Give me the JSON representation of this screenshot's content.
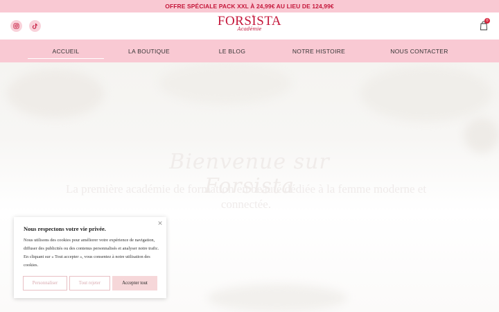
{
  "promo": {
    "text": "OFFRE SPÉCIALE PACK XXL À 24,99€ AU LIEU DE 124,99€"
  },
  "header": {
    "social": [
      {
        "icon": "instagram-icon"
      },
      {
        "icon": "tiktok-icon"
      }
    ],
    "logo": {
      "main": "FORSISTA",
      "sub": "Académie"
    },
    "cart": {
      "count": "0"
    }
  },
  "nav": {
    "items": [
      {
        "label": "ACCUEIL",
        "active": true
      },
      {
        "label": "LA BOUTIQUE"
      },
      {
        "label": "LE BLOG"
      },
      {
        "label": "NOTRE HISTOIRE"
      },
      {
        "label": "NOUS CONTACTER"
      }
    ]
  },
  "hero": {
    "title": "Bienvenue sur Forsista",
    "subtitle": "La première académie de formation en beauté dédiée à la femme moderne et connectée."
  },
  "cookie": {
    "title": "Nous respectons votre vie privée.",
    "text": "Nous utilisons des cookies pour améliorer votre expérience de navigation, diffuser des publicités ou des contenus personnalisés et analyser notre trafic. En cliquant sur « Tout accepter », vous consentez à notre utilisation des cookies.",
    "customize": "Personnaliser",
    "reject": "Tout rejeter",
    "accept": "Accepter tout"
  },
  "colors": {
    "accent": "#c4163a",
    "pink": "#f9c9d3",
    "button": "#f6d7d9"
  }
}
